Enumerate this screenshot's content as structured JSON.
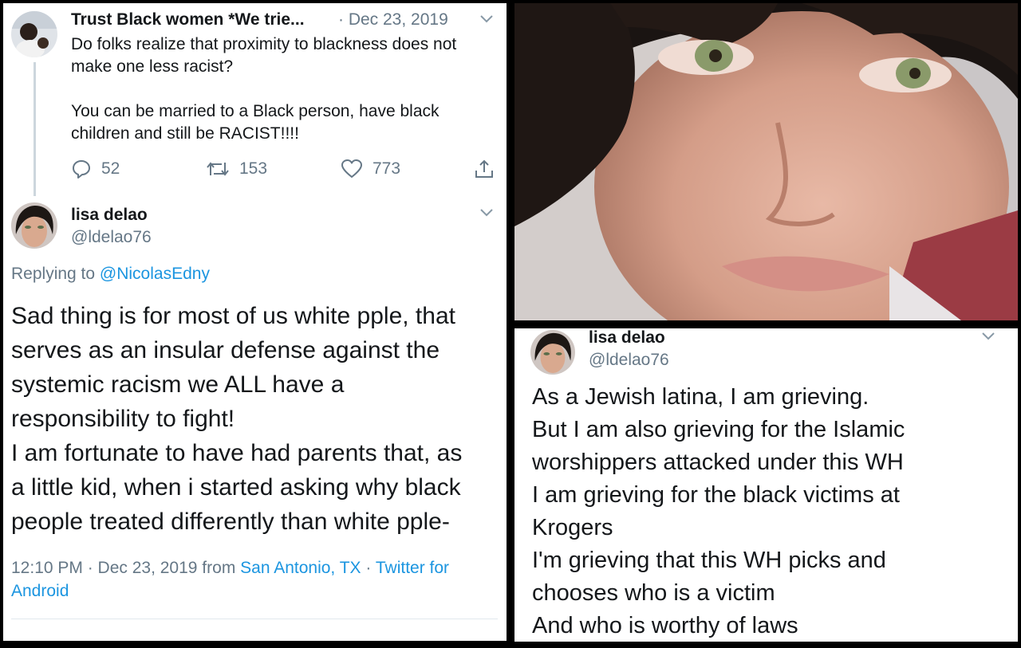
{
  "parent_tweet": {
    "author_name": "Trust Black women *We trie...",
    "date": "· Dec 23, 2019",
    "text_lines": [
      "Do folks realize that proximity to blackness does not",
      "make one less racist?",
      "",
      "You can be married to a Black person, have black",
      "children and still be RACIST!!!!"
    ],
    "actions": {
      "replies": "52",
      "retweets": "153",
      "likes": "773"
    }
  },
  "reply_tweet": {
    "author_name": "lisa delao",
    "handle": "@ldelao76",
    "replying_prefix": "Replying to",
    "replying_to": "@NicolasEdny",
    "text_lines": [
      "Sad thing is for most of us white pple, that",
      "serves as an insular defense against the",
      "systemic racism we ALL have a",
      "responsibility to fight!",
      "I am fortunate to have had parents that, as",
      "a little kid, when i started asking why black",
      "people treated differently than white pple-"
    ],
    "meta": {
      "time_date": "12:10 PM · Dec 23, 2019 from",
      "location": "San Antonio, TX",
      "separator": "·",
      "source": "Twitter for Android"
    }
  },
  "right_tweet": {
    "author_name": "lisa delao",
    "handle": "@ldelao76",
    "text_lines": [
      "As a Jewish latina, I am grieving.",
      "But I am also grieving for the Islamic",
      "worshippers attacked under this WH",
      "I am grieving for the black victims at",
      "Krogers",
      "I'm grieving that this WH picks and",
      "chooses who is a victim",
      "And who is  worthy of laws"
    ]
  },
  "colors": {
    "background": "#000000",
    "text": "#14171a",
    "secondary": "#657786",
    "link": "#1b95e0"
  },
  "icons": [
    "chevron-down-icon",
    "reply-icon",
    "retweet-icon",
    "like-icon",
    "share-icon"
  ]
}
